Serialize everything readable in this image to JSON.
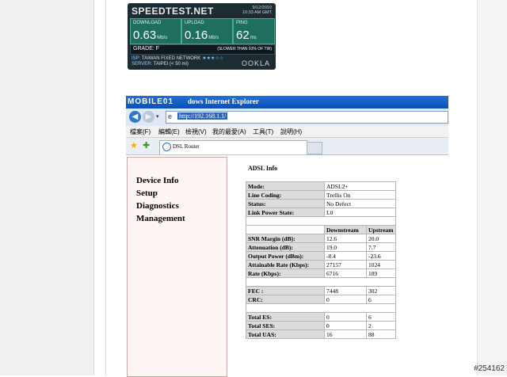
{
  "speedtest": {
    "logo": "SPEEDTEST.NET",
    "date": "9/12/2010",
    "time": "10:33 AM GMT",
    "download_label": "DOWNLOAD",
    "download_value": "0.63",
    "download_unit": "Mb/s",
    "upload_label": "UPLOAD",
    "upload_value": "0.16",
    "upload_unit": "Mb/s",
    "ping_label": "PING",
    "ping_value": "62",
    "ping_unit": "ms",
    "grade": "GRADE: F",
    "slower": "(SLOWER THAN 93% OF TW)",
    "isp_label": "ISP:",
    "isp": "TAIWAN FIXED NETWORK",
    "stars": "★★★☆☆",
    "server_label": "SERVER:",
    "server": "TAIPEI (< 50 mi)",
    "ookla": "OOKLA"
  },
  "browser": {
    "brand": "MOBILE01",
    "title_suffix": "dows Internet Explorer",
    "url": "http://192.168.1.1/",
    "menu": [
      "檔案(F)",
      "編輯(E)",
      "檢視(V)",
      "我的最愛(A)",
      "工具(T)",
      "說明(H)"
    ],
    "tab_title": "DSL Router",
    "nav": [
      "Device Info",
      "Setup",
      "Diagnostics",
      "Management"
    ]
  },
  "adsl": {
    "title": "ADSL Info",
    "rows1": [
      {
        "k": "Mode:",
        "v": "ADSL2+"
      },
      {
        "k": "Line Coding:",
        "v": "Trellis On"
      },
      {
        "k": "Status:",
        "v": "No Defect"
      },
      {
        "k": "Link Power State:",
        "v": "L0"
      }
    ],
    "headers": [
      "Downstream",
      "Upstream"
    ],
    "rows2": [
      {
        "k": "SNR Margin (dB):",
        "d": "12.6",
        "u": "20.0"
      },
      {
        "k": "Attenuation (dB):",
        "d": "19.0",
        "u": "7.7"
      },
      {
        "k": "Output Power (dBm):",
        "d": "-8.4",
        "u": "-23.6"
      },
      {
        "k": "Attainable Rate (Kbps):",
        "d": "27157",
        "u": "1024"
      },
      {
        "k": "Rate (Kbps):",
        "d": "6716",
        "u": "189"
      }
    ],
    "rows3": [
      {
        "k": "FEC :",
        "d": "7448",
        "u": "302"
      },
      {
        "k": "CRC:",
        "d": "0",
        "u": "6"
      }
    ],
    "rows4": [
      {
        "k": "Total ES:",
        "d": "0",
        "u": "6"
      },
      {
        "k": "Total SES:",
        "d": "0",
        "u": "2"
      },
      {
        "k": "Total UAS:",
        "d": "16",
        "u": "88"
      }
    ]
  },
  "watermark": "#254162"
}
